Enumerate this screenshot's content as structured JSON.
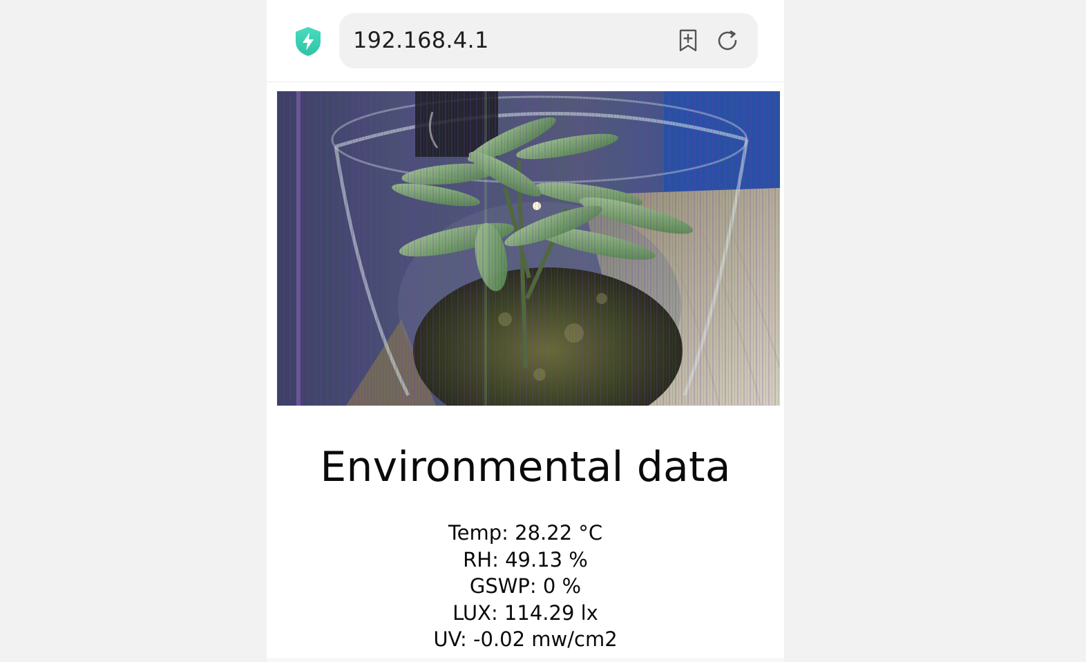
{
  "browser": {
    "url": "192.168.4.1",
    "security_icon": "shield-bolt-icon",
    "bookmark_icon": "bookmark-add-icon",
    "reload_icon": "reload-icon",
    "accent_color": "#3dd4b4"
  },
  "page": {
    "camera_image": "plant terrarium camera snapshot",
    "heading": "Environmental data",
    "readings": [
      "Temp: 28.22 °C",
      "RH: 49.13 %",
      "GSWP: 0 %",
      "LUX: 114.29 lx",
      "UV: -0.02 mw/cm2"
    ]
  }
}
